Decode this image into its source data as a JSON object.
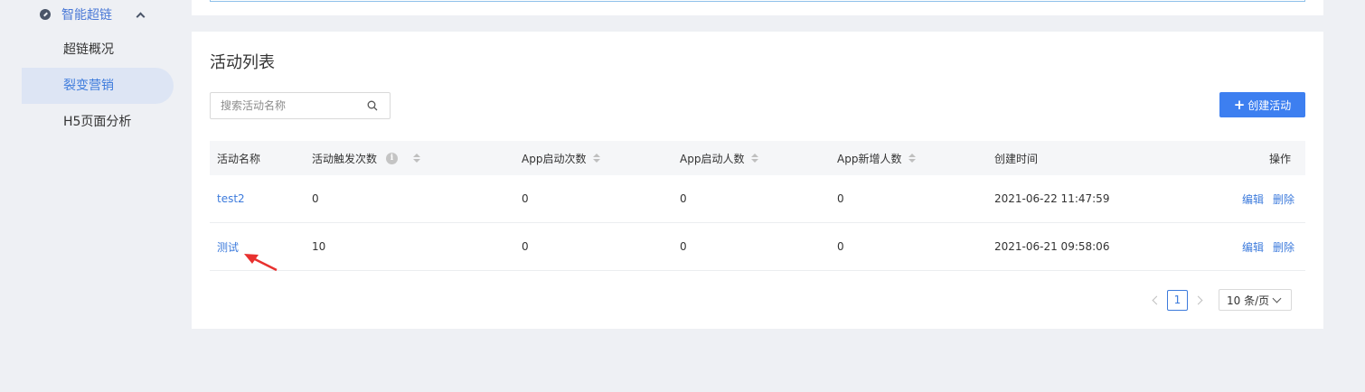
{
  "sidebar": {
    "group_label": "智能超链",
    "items": [
      {
        "label": "超链概况",
        "active": false
      },
      {
        "label": "裂变营销",
        "active": true
      },
      {
        "label": "H5页面分析",
        "active": false
      }
    ]
  },
  "main": {
    "title": "活动列表",
    "search_placeholder": "搜索活动名称",
    "create_button": {
      "icon": "+",
      "label": "创建活动"
    },
    "table": {
      "headers": [
        "活动名称",
        "活动触发次数",
        "App启动次数",
        "App启动人数",
        "App新增人数",
        "创建时间",
        "操作"
      ],
      "info_icon": "i",
      "rows": [
        {
          "name": "test2",
          "triggers": "0",
          "app_launches": "0",
          "app_users": "0",
          "new_users": "0",
          "created": "2021-06-22 11:47:59",
          "edit": "编辑",
          "delete": "删除"
        },
        {
          "name": "测试",
          "triggers": "10",
          "app_launches": "0",
          "app_users": "0",
          "new_users": "0",
          "created": "2021-06-21 09:58:06",
          "edit": "编辑",
          "delete": "删除"
        }
      ]
    },
    "pagination": {
      "current": "1",
      "page_size": "10 条/页"
    }
  },
  "colors": {
    "accent": "#3d7ff0",
    "link": "#3d7bdc",
    "annotation_arrow": "#e8312f"
  }
}
